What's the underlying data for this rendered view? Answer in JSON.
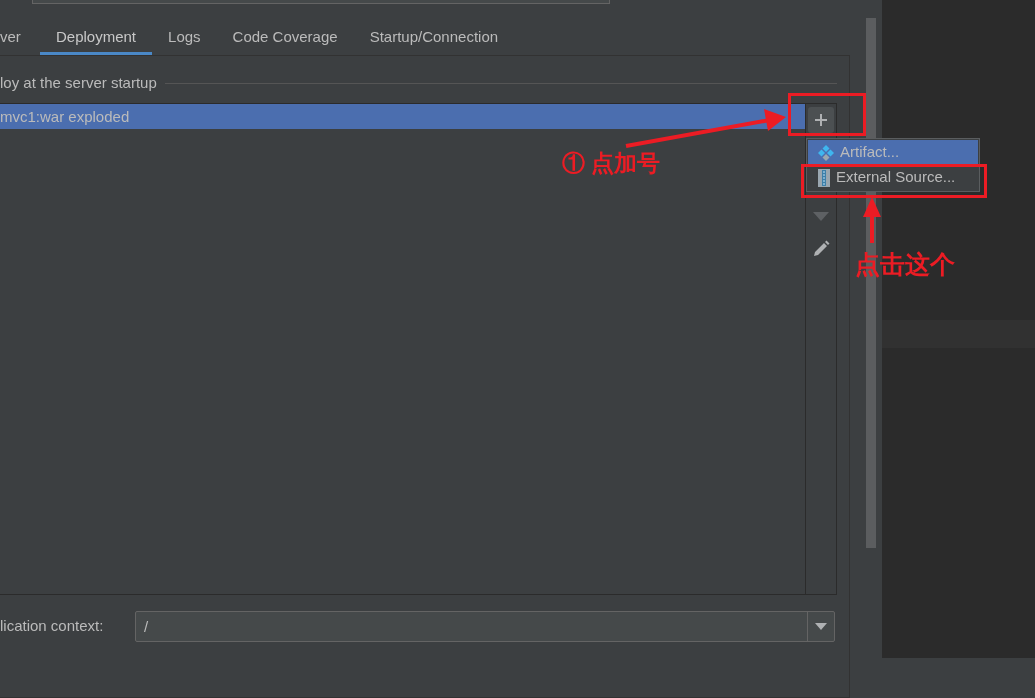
{
  "tabs": [
    {
      "label": "ver",
      "selected": false
    },
    {
      "label": "Deployment",
      "selected": true
    },
    {
      "label": "Logs",
      "selected": false
    },
    {
      "label": "Code Coverage",
      "selected": false
    },
    {
      "label": "Startup/Connection",
      "selected": false
    }
  ],
  "deploy_group": {
    "title": "loy at the server startup"
  },
  "deployments": [
    {
      "label": "mvc1:war exploded",
      "selected": true
    }
  ],
  "toolbar": [
    {
      "kind": "add",
      "disabled": false
    },
    {
      "kind": "move_down",
      "disabled": true
    },
    {
      "kind": "edit",
      "disabled": false
    }
  ],
  "add_menu": [
    {
      "kind": "artifact",
      "label": "Artifact...",
      "selected": true
    },
    {
      "kind": "external",
      "label": "External Source...",
      "selected": false
    }
  ],
  "application_context": {
    "label": "lication context:",
    "value": "/"
  },
  "annotations": [
    {
      "text": "① 点加号"
    },
    {
      "text": "点击这个"
    }
  ]
}
